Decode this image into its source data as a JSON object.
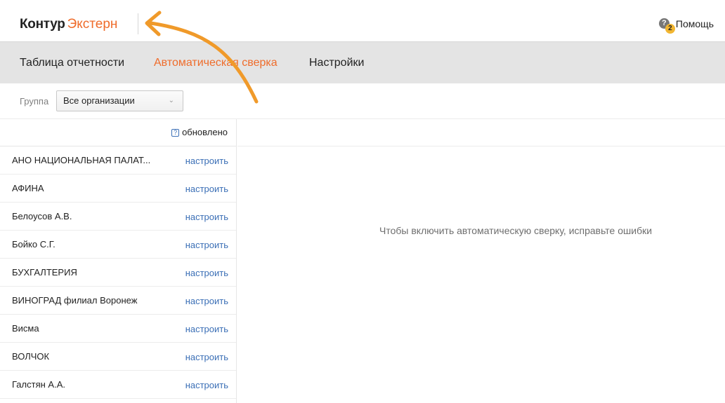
{
  "header": {
    "brand": "Контур",
    "product": "Экстерн",
    "switcher_glyph": "‹",
    "help": {
      "label": "Помощь",
      "badge_count": "2",
      "icon": "help-question-icon"
    }
  },
  "nav": {
    "tabs": [
      {
        "label": "Таблица отчетности",
        "active": false
      },
      {
        "label": "Автоматическая сверка",
        "active": true
      },
      {
        "label": "Настройки",
        "active": false
      }
    ]
  },
  "filter": {
    "label": "Группа",
    "selected": "Все организации"
  },
  "list": {
    "updated_label": "обновлено",
    "rows": [
      {
        "name": "АНО НАЦИОНАЛЬНАЯ ПАЛАТ...",
        "action": "настроить"
      },
      {
        "name": "АФИНА",
        "action": "настроить"
      },
      {
        "name": "Белоусов А.В.",
        "action": "настроить"
      },
      {
        "name": "Бойко С.Г.",
        "action": "настроить"
      },
      {
        "name": "БУХГАЛТЕРИЯ",
        "action": "настроить"
      },
      {
        "name": "ВИНОГРАД филиал Воронеж",
        "action": "настроить"
      },
      {
        "name": "Висма",
        "action": "настроить"
      },
      {
        "name": "ВОЛЧОК",
        "action": "настроить"
      },
      {
        "name": "Галстян А.А.",
        "action": "настроить"
      }
    ]
  },
  "main": {
    "message": "Чтобы включить автоматическую сверку, исправьте ошибки"
  },
  "colors": {
    "accent": "#ef6c2b",
    "link": "#3b6fb6",
    "nav_bg": "#e4e4e4",
    "annotation_arrow": "#f09a2a"
  }
}
